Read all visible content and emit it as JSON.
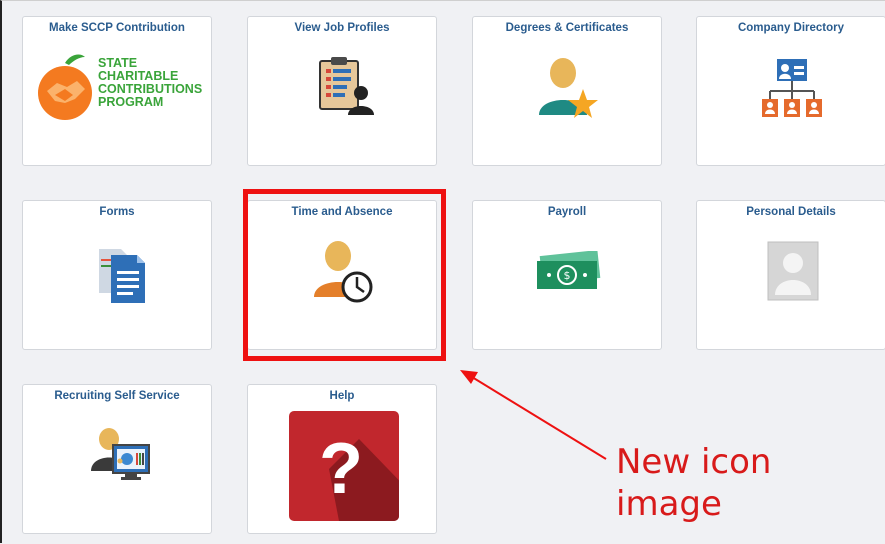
{
  "tiles": [
    {
      "title": "Make SCCP Contribution"
    },
    {
      "title": "View Job Profiles"
    },
    {
      "title": "Degrees & Certificates"
    },
    {
      "title": "Company Directory"
    },
    {
      "title": "Forms"
    },
    {
      "title": "Time and Absence"
    },
    {
      "title": "Payroll"
    },
    {
      "title": "Personal Details"
    },
    {
      "title": "Recruiting Self Service"
    },
    {
      "title": "Help"
    }
  ],
  "sccp_logo": {
    "line1": "STATE",
    "line2": "CHARITABLE",
    "line3": "CONTRIBUTIONS",
    "line4": "PROGRAM"
  },
  "annotation": {
    "text": "New icon image"
  },
  "colors": {
    "tile_title": "#2a5c8e",
    "highlight": "#ee1111",
    "annotation": "#d81a1a",
    "sccp_green": "#3aa43a",
    "orange": "#f47a20",
    "help_red": "#c1272d"
  },
  "icons": {
    "sccp": "orange-handshake-icon",
    "job_profiles": "clipboard-person-icon",
    "degrees": "person-star-icon",
    "directory": "org-chart-icon",
    "forms": "documents-icon",
    "time": "person-clock-icon",
    "payroll": "money-icon",
    "personal": "profile-placeholder-icon",
    "recruiting": "person-monitor-icon",
    "help": "question-mark-icon"
  }
}
